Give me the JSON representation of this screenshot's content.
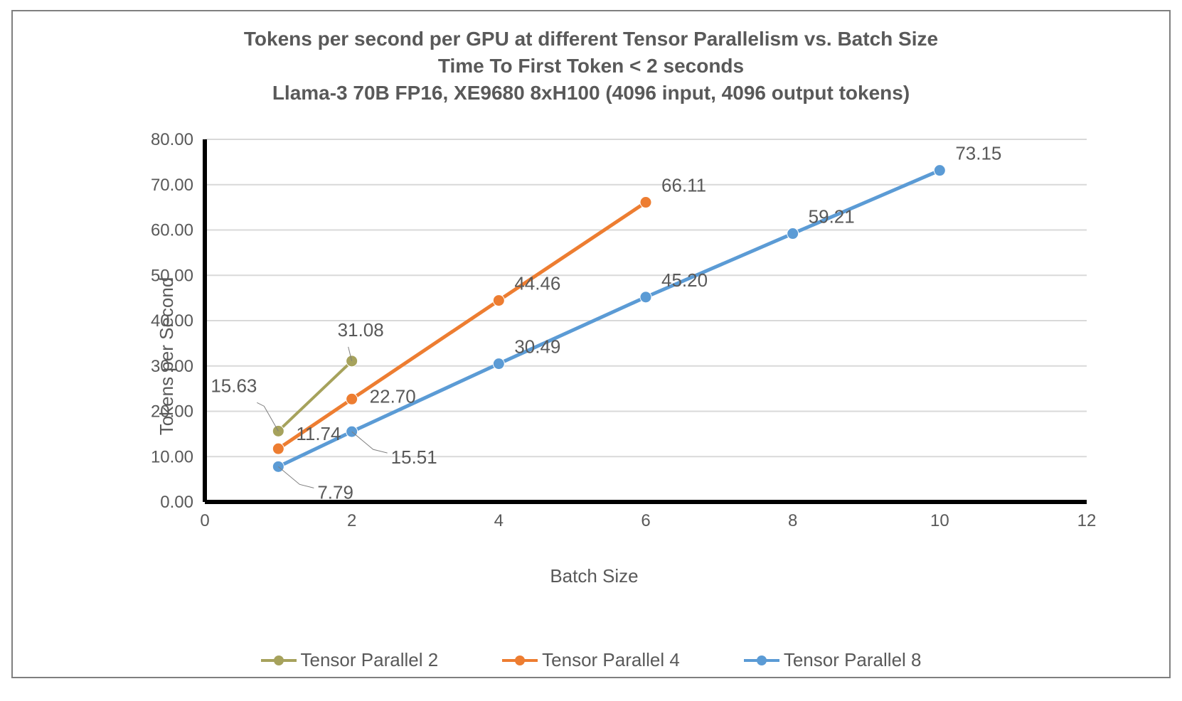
{
  "chart_data": {
    "type": "line",
    "title_line1": "Tokens per second per GPU at different Tensor Parallelism vs. Batch Size",
    "title_line2": "Time To First Token < 2 seconds",
    "title_line3": "Llama-3 70B FP16, XE9680 8xH100 (4096 input, 4096 output tokens)",
    "xlabel": "Batch Size",
    "ylabel": "Tokens per Second",
    "x_ticks": [
      0,
      2,
      4,
      6,
      8,
      10,
      12
    ],
    "y_ticks": [
      0.0,
      10.0,
      20.0,
      30.0,
      40.0,
      50.0,
      60.0,
      70.0,
      80.0
    ],
    "xlim": [
      0,
      12
    ],
    "ylim": [
      0,
      80
    ],
    "series": [
      {
        "name": "Tensor Parallel 2",
        "color": "#a6a25c",
        "points": [
          {
            "x": 1,
            "y": 15.63
          },
          {
            "x": 2,
            "y": 31.08
          }
        ]
      },
      {
        "name": "Tensor Parallel 4",
        "color": "#ed7d31",
        "points": [
          {
            "x": 1,
            "y": 11.74
          },
          {
            "x": 2,
            "y": 22.7
          },
          {
            "x": 4,
            "y": 44.46
          },
          {
            "x": 6,
            "y": 66.11
          }
        ]
      },
      {
        "name": "Tensor Parallel 8",
        "color": "#5b9bd5",
        "points": [
          {
            "x": 1,
            "y": 7.79
          },
          {
            "x": 2,
            "y": 15.51
          },
          {
            "x": 4,
            "y": 30.49
          },
          {
            "x": 6,
            "y": 45.2
          },
          {
            "x": 8,
            "y": 59.21
          },
          {
            "x": 10,
            "y": 73.15
          }
        ]
      }
    ],
    "legend_position": "bottom",
    "grid": "horizontal"
  }
}
